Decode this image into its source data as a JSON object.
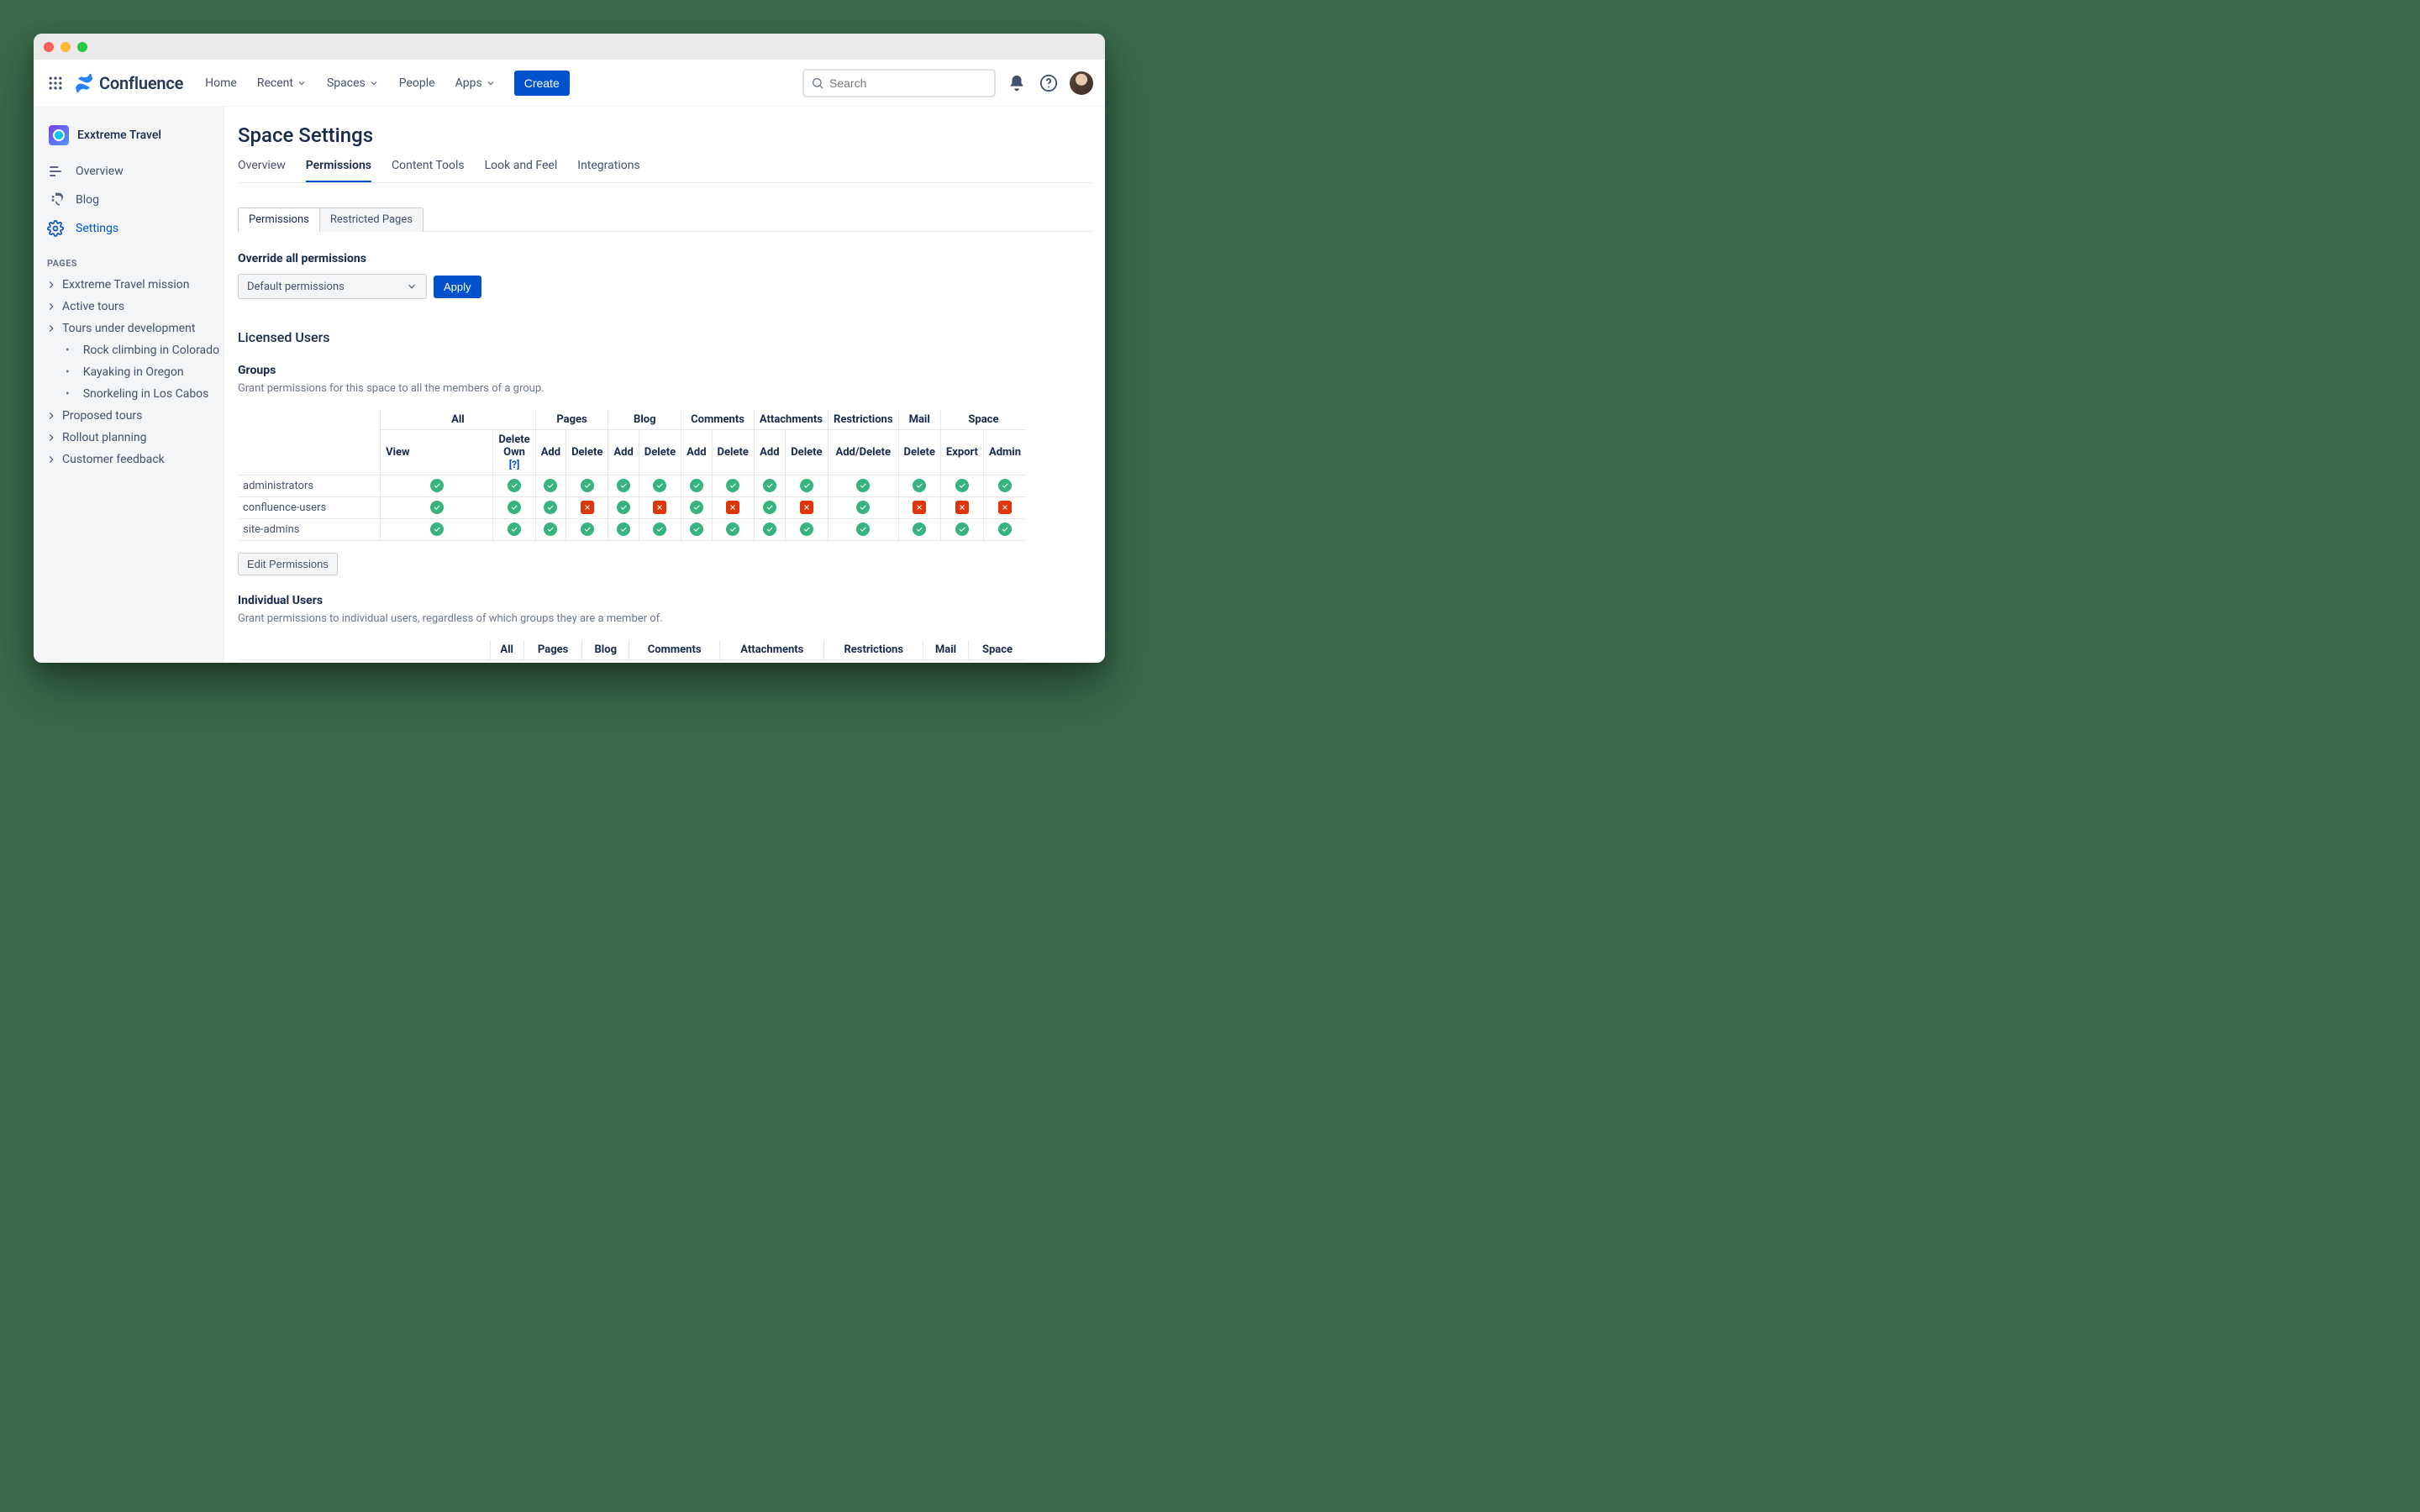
{
  "product": "Confluence",
  "nav": {
    "home": "Home",
    "recent": "Recent",
    "spaces": "Spaces",
    "people": "People",
    "apps": "Apps",
    "create": "Create"
  },
  "search": {
    "placeholder": "Search"
  },
  "space": {
    "name": "Exxtreme Travel"
  },
  "sidebar": {
    "overview": "Overview",
    "blog": "Blog",
    "settings": "Settings",
    "pages_label": "PAGES",
    "pages": [
      {
        "label": "Exxtreme Travel mission"
      },
      {
        "label": "Active tours"
      },
      {
        "label": "Tours under development",
        "children": [
          {
            "label": "Rock climbing in Colorado"
          },
          {
            "label": "Kayaking in Oregon"
          },
          {
            "label": "Snorkeling in Los Cabos"
          }
        ]
      },
      {
        "label": "Proposed tours"
      },
      {
        "label": "Rollout planning"
      },
      {
        "label": "Customer feedback"
      }
    ]
  },
  "page": {
    "title": "Space Settings",
    "tabs": [
      "Overview",
      "Permissions",
      "Content Tools",
      "Look and Feel",
      "Integrations"
    ],
    "active_tab": "Permissions",
    "subtabs": [
      "Permissions",
      "Restricted Pages"
    ],
    "active_subtab": "Permissions",
    "override_heading": "Override all permissions",
    "override_select": "Default permissions",
    "apply": "Apply",
    "licensed_users": "Licensed Users",
    "groups_heading": "Groups",
    "groups_desc": "Grant permissions for this space to all the members of a group.",
    "columns": {
      "groups": [
        "All",
        "Pages",
        "Blog",
        "Comments",
        "Attachments",
        "Restrictions",
        "Mail",
        "Space"
      ],
      "sub": {
        "all": [
          "View",
          "Delete Own"
        ],
        "pages": [
          "Add",
          "Delete"
        ],
        "blog": [
          "Add",
          "Delete"
        ],
        "comments": [
          "Add",
          "Delete"
        ],
        "attachments": [
          "Add",
          "Delete"
        ],
        "restrictions": [
          "Add/Delete"
        ],
        "mail": [
          "Delete"
        ],
        "space": [
          "Export",
          "Admin"
        ]
      },
      "help": "[?]"
    },
    "group_rows": [
      {
        "name": "administrators",
        "perms": [
          true,
          true,
          true,
          true,
          true,
          true,
          true,
          true,
          true,
          true,
          true,
          true,
          true,
          true
        ]
      },
      {
        "name": "confluence-users",
        "perms": [
          true,
          true,
          true,
          false,
          true,
          false,
          true,
          false,
          true,
          false,
          true,
          false,
          false,
          false
        ]
      },
      {
        "name": "site-admins",
        "perms": [
          true,
          true,
          true,
          true,
          true,
          true,
          true,
          true,
          true,
          true,
          true,
          true,
          true,
          true
        ]
      }
    ],
    "edit_permissions": "Edit Permissions",
    "individual_heading": "Individual Users",
    "individual_desc": "Grant permissions to individual users, regardless of which groups they are a member of."
  }
}
